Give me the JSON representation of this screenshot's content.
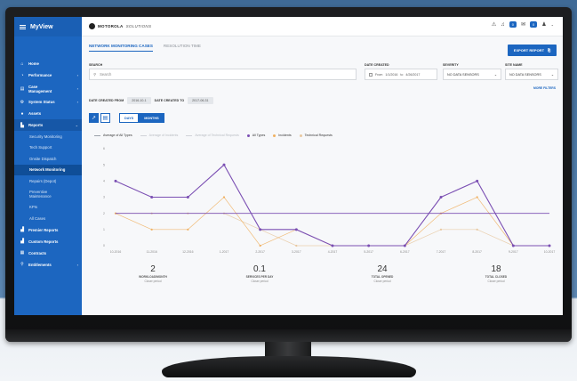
{
  "app": {
    "title": "MyView"
  },
  "brand": {
    "name": "MOTOROLA",
    "suffix": "SOLUTIONS"
  },
  "topbar": {
    "badge1": "0",
    "badge2": "0"
  },
  "sidebar": {
    "items": [
      {
        "label": "Home"
      },
      {
        "label": "Performance"
      },
      {
        "label": "Case Management"
      },
      {
        "label": "System Status"
      },
      {
        "label": "Assets"
      },
      {
        "label": "Reports"
      }
    ],
    "sub_items": [
      {
        "label": "Security Monitoring"
      },
      {
        "label": "Tech Support"
      },
      {
        "label": "Onsite Dispatch"
      },
      {
        "label": "Network Monitoring"
      },
      {
        "label": "Repairs (Depot)"
      },
      {
        "label": "Preventive Maintenance"
      },
      {
        "label": "KPIs"
      },
      {
        "label": "All Cases"
      }
    ],
    "bottom_items": [
      {
        "label": "Premier Reports"
      },
      {
        "label": "Custom Reports"
      },
      {
        "label": "Contracts"
      },
      {
        "label": "Entitlements"
      }
    ]
  },
  "tabs": [
    {
      "label": "NETWORK MONITORING CASES"
    },
    {
      "label": "RESOLUTION TIME"
    }
  ],
  "export_label": "EXPORT REPORT",
  "filters": {
    "search_label": "SEARCH",
    "search_placeholder": "Search",
    "date_label": "DATE CREATED",
    "date_from_prefix": "From",
    "date_from": "1/1/2016",
    "date_to_prefix": "to",
    "date_to": "4/26/2017",
    "severity_label": "SEVERITY",
    "severity_value": "NO DATA SENSORS",
    "site_label": "SITE NAME",
    "site_value": "NO DATA SENSORS",
    "more_filters": "MORE FILTERS"
  },
  "date_range": {
    "from_label": "DATE CREATED FROM",
    "from_value": "2016-10-1",
    "to_label": "DATE CREATED TO",
    "to_value": "2017-06-31"
  },
  "view": {
    "days_label": "DAYS",
    "months_label": "MONTHS"
  },
  "legend": [
    {
      "label": "Average of All Types",
      "color": "#9aa0a8",
      "style": "dash"
    },
    {
      "label": "Average of Incidents",
      "color": "#d0d3d8",
      "style": "dash"
    },
    {
      "label": "Average of Technical Requests",
      "color": "#d0d3d8",
      "style": "dash"
    },
    {
      "label": "All Types",
      "color": "#7b4fb3",
      "style": "dot"
    },
    {
      "label": "Incidents",
      "color": "#f0b060",
      "style": "dot"
    },
    {
      "label": "Technical Requests",
      "color": "#e8c8a0",
      "style": "dot"
    }
  ],
  "chart_data": {
    "type": "line",
    "x": [
      "10-2016",
      "11-2016",
      "12-2016",
      "1-2017",
      "2-2017",
      "3-2017",
      "4-2017",
      "5-2017",
      "6-2017",
      "7-2017",
      "8-2017",
      "9-2017",
      "10-2017"
    ],
    "ylim": [
      0,
      6
    ],
    "yticks": [
      0,
      1,
      2,
      3,
      4,
      5,
      6
    ],
    "series": [
      {
        "name": "All Types",
        "color": "#7b4fb3",
        "values": [
          4,
          3,
          3,
          5,
          1,
          1,
          0,
          0,
          0,
          3,
          4,
          0,
          0
        ]
      },
      {
        "name": "Incidents",
        "color": "#f0b060",
        "values": [
          2,
          1,
          1,
          3,
          0,
          1,
          0,
          0,
          0,
          2,
          3,
          0,
          0
        ]
      },
      {
        "name": "Technical Requests",
        "color": "#e8c8a0",
        "values": [
          2,
          2,
          2,
          2,
          1,
          0,
          0,
          0,
          0,
          1,
          1,
          0,
          0
        ]
      },
      {
        "name": "Average of All Types",
        "color": "#7b4fb3",
        "values": [
          2,
          2,
          2,
          2,
          2,
          2,
          2,
          2,
          2,
          2,
          2,
          2,
          2
        ]
      }
    ],
    "grid": false
  },
  "stats": [
    {
      "value": "2",
      "label": "WORKLOAD/MONTH",
      "period": "Closer period"
    },
    {
      "value": "0.1",
      "label": "SERVICES PER DAY",
      "period": "Closer period"
    },
    {
      "value": "24",
      "label": "TOTAL OPENED",
      "period": "Closer period"
    },
    {
      "value": "18",
      "label": "TOTAL CLOSED",
      "period": "Closer period"
    }
  ]
}
